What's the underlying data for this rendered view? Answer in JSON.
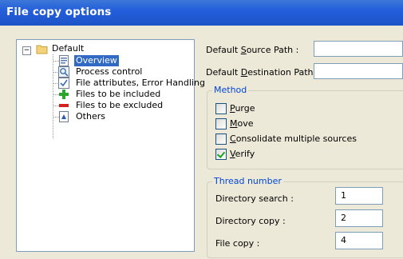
{
  "window": {
    "title": "File copy options"
  },
  "tree": {
    "root": {
      "label": "Default",
      "expander": "−"
    },
    "items": [
      {
        "label": "Overview",
        "icon": "overview-icon",
        "selected": true
      },
      {
        "label": "Process control",
        "icon": "process-control-icon"
      },
      {
        "label": "File attributes, Error Handling",
        "icon": "file-attributes-icon"
      },
      {
        "label": "Files to be included",
        "icon": "plus-icon"
      },
      {
        "label": "Files to be excluded",
        "icon": "minus-icon"
      },
      {
        "label": "Others",
        "icon": "others-icon"
      }
    ]
  },
  "paths": {
    "source": {
      "pre": "Default ",
      "accel": "S",
      "post": "ource Path :",
      "value": ""
    },
    "destination": {
      "pre": "Default ",
      "accel": "D",
      "post": "estination Path :",
      "value": ""
    }
  },
  "method": {
    "caption": "Method",
    "options": [
      {
        "accel": "P",
        "rest": "urge",
        "checked": false
      },
      {
        "accel": "M",
        "rest": "ove",
        "checked": false
      },
      {
        "accel": "C",
        "rest": "onsolidate multiple sources",
        "checked": false
      },
      {
        "accel": "V",
        "rest": "erify",
        "checked": true
      }
    ]
  },
  "threads": {
    "caption": "Thread number",
    "rows": [
      {
        "label": "Directory search :",
        "value": "1"
      },
      {
        "label": "Directory copy :",
        "value": "2"
      },
      {
        "label": "File copy :",
        "value": "4"
      }
    ]
  },
  "colors": {
    "titlebar": "#245edb",
    "selection": "#316ac5",
    "group_caption": "#0046d5"
  }
}
